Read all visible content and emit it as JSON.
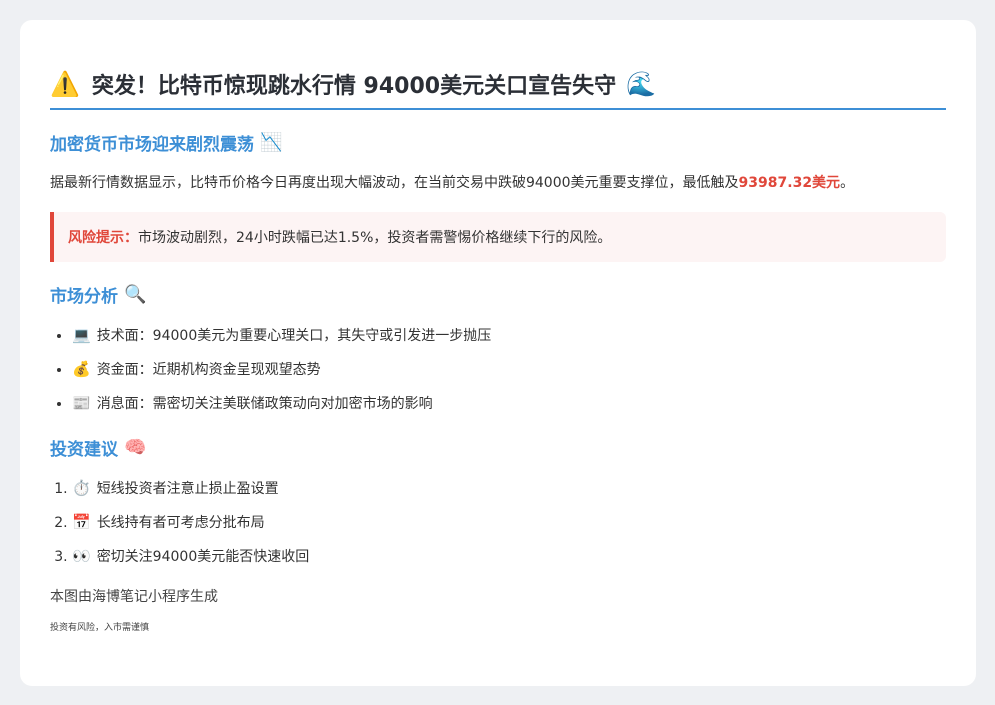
{
  "title": {
    "icon_start": "⚠️",
    "text": "突发！比特币惊现跳水行情 94000美元关口宣告失守",
    "icon_end": "🌊"
  },
  "section1": {
    "heading": "加密货币市场迎来剧烈震荡",
    "icon": "📉",
    "para_before": "据最新行情数据显示，比特币价格今日再度出现大幅波动，在当前交易中跌破94000美元重要支撑位，最低触及",
    "price": "93987.32美元",
    "para_after": "。"
  },
  "warning": {
    "label": "风险提示：",
    "text": "市场波动剧烈，24小时跌幅已达1.5%，投资者需警惕价格继续下行的风险。",
    "color": "#e0473a"
  },
  "analysis": {
    "heading": "市场分析",
    "icon": "🔍",
    "items": [
      {
        "icon": "💻",
        "text": "技术面：94000美元为重要心理关口，其失守或引发进一步抛压"
      },
      {
        "icon": "💰",
        "text": "资金面：近期机构资金呈现观望态势"
      },
      {
        "icon": "📰",
        "text": "消息面：需密切关注美联储政策动向对加密市场的影响"
      }
    ]
  },
  "advice": {
    "heading": "投资建议",
    "icon": "🧠",
    "items": [
      {
        "icon": "⏱️",
        "text": "短线投资者注意止损止盈设置"
      },
      {
        "icon": "📅",
        "text": "长线持有者可考虑分批布局"
      },
      {
        "icon": "👀",
        "text": "密切关注94000美元能否快速收回"
      }
    ]
  },
  "footer": {
    "credit": "本图由海博笔记小程序生成",
    "disclaimer": "投资有风险，入市需谨慎"
  },
  "colors": {
    "accent": "#3d8fd6",
    "danger": "#e0473a",
    "background": "#eef0f3"
  }
}
